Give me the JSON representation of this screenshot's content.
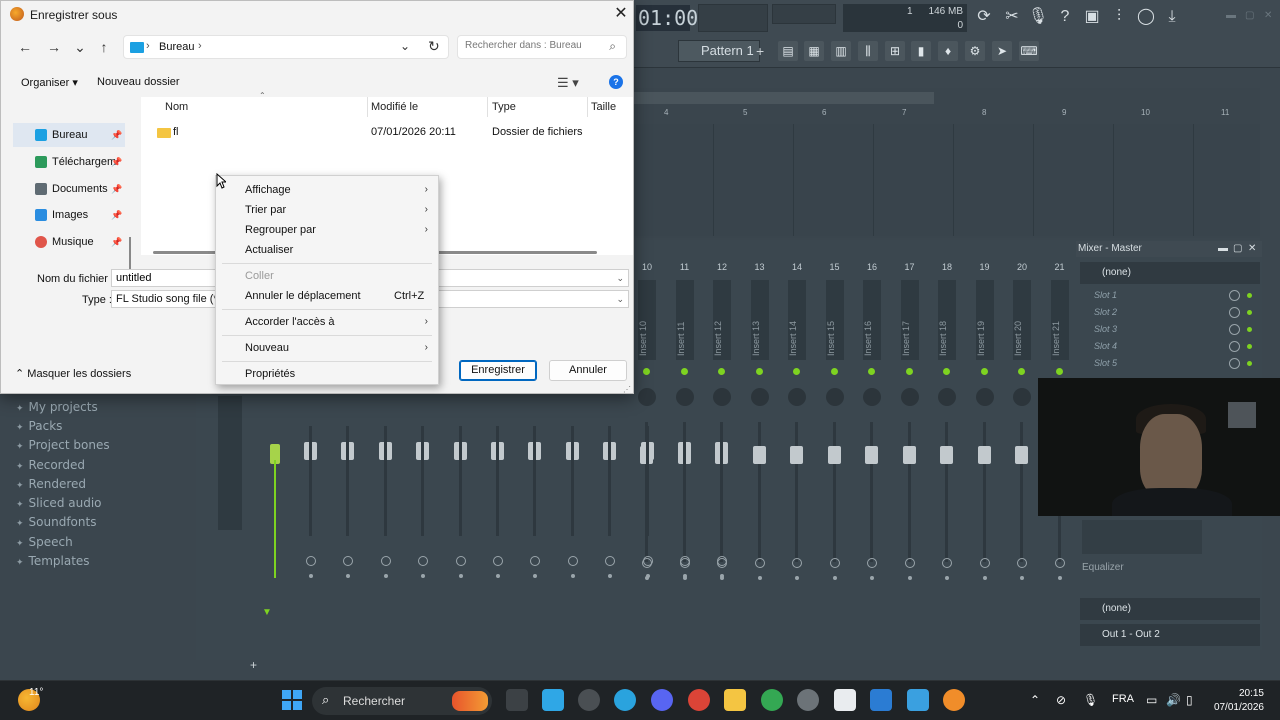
{
  "dialog": {
    "title": "Enregistrer sous",
    "address": {
      "crumb": "Bureau"
    },
    "search_placeholder": "Rechercher dans : Bureau",
    "commands": {
      "organize": "Organiser ▾",
      "new_folder": "Nouveau dossier"
    },
    "nav": [
      {
        "label": "Bureau",
        "icon": "desktop-icon",
        "color": "#1ba0e2"
      },
      {
        "label": "Téléchargem",
        "icon": "download-icon",
        "color": "#2c9a5b"
      },
      {
        "label": "Documents",
        "icon": "document-icon",
        "color": "#5f6b73"
      },
      {
        "label": "Images",
        "icon": "image-icon",
        "color": "#2a8de0"
      },
      {
        "label": "Musique",
        "icon": "music-icon",
        "color": "#e0554a"
      }
    ],
    "columns": {
      "name": "Nom",
      "modified": "Modifié le",
      "type": "Type",
      "size": "Taille"
    },
    "files": [
      {
        "name": "fl",
        "modified": "07/01/2026 20:11",
        "type": "Dossier de fichiers"
      }
    ],
    "filename_label": "Nom du fichier :",
    "filename_value": "untitled",
    "type_label": "Type :",
    "type_value": "FL Studio song file (*.flp)",
    "hide_folders": "Masquer les dossiers",
    "save_button": "Enregistrer",
    "cancel_button": "Annuler"
  },
  "context_menu": {
    "items": [
      {
        "label": "Affichage",
        "submenu": true
      },
      {
        "label": "Trier par",
        "submenu": true
      },
      {
        "label": "Regrouper par",
        "submenu": true
      },
      {
        "label": "Actualiser"
      },
      {
        "label": "Coller",
        "disabled": true
      },
      {
        "label": "Annuler le déplacement",
        "shortcut": "Ctrl+Z"
      },
      {
        "label": "Accorder l'accès à",
        "submenu": true
      },
      {
        "label": "Nouveau",
        "submenu": true
      },
      {
        "label": "Propriétés"
      }
    ]
  },
  "fl": {
    "time": "01:00",
    "memory": "146 MB",
    "cpu_top": "1",
    "cpu_bottom": "0",
    "pattern": "Pattern 1",
    "ruler": [
      "4",
      "5",
      "6",
      "7",
      "8",
      "9",
      "10",
      "11"
    ],
    "mixer_title": "Mixer - Master",
    "mixer_numbers": [
      "10",
      "11",
      "12",
      "13",
      "14",
      "15",
      "16",
      "17",
      "18",
      "19",
      "20",
      "21"
    ],
    "mixer_inserts": [
      "Insert 10",
      "Insert 11",
      "Insert 12",
      "Insert 13",
      "Insert 14",
      "Insert 15",
      "Insert 16",
      "Insert 17",
      "Insert 18",
      "Insert 19",
      "Insert 20",
      "Insert 21"
    ],
    "fx_none": "(none)",
    "slots": [
      "Slot 1",
      "Slot 2",
      "Slot 3",
      "Slot 4",
      "Slot 5"
    ],
    "equalizer": "Equalizer",
    "eq_none": "(none)",
    "output": "Out 1 - Out 2",
    "browser": [
      "My projects",
      "Packs",
      "Project bones",
      "Recorded",
      "Rendered",
      "Sliced audio",
      "Soundfonts",
      "Speech",
      "Templates"
    ]
  },
  "taskbar": {
    "temperature": "11°",
    "search": "Rechercher",
    "lang": "FRA",
    "time": "20:15",
    "date": "07/01/2026"
  },
  "colors": {
    "accent": "#0067c0",
    "folder": "#f4c542",
    "led": "#7ed321"
  }
}
